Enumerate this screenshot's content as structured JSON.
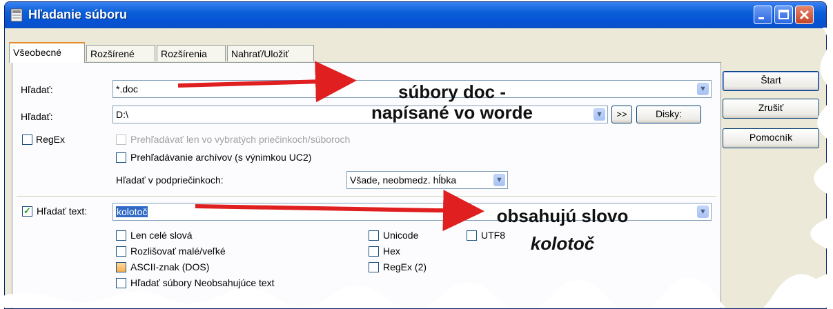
{
  "window": {
    "title": "Hľadanie súboru",
    "colors": {
      "titlebar": "#0a5fd8",
      "arrow": "#e02020",
      "face": "#ece9d8"
    }
  },
  "tabs": [
    {
      "label": "Všeobecné",
      "active": true
    },
    {
      "label": "Rozšírené",
      "active": false
    },
    {
      "label": "Rozšírenia",
      "active": false
    },
    {
      "label": "Nahrať/Uložiť",
      "active": false
    }
  ],
  "general": {
    "search_label": "Hľadať:",
    "search_value": "*.doc",
    "path_label": "Hľadať:",
    "path_value": "D:\\",
    "more_button": ">>",
    "drives_button": "Disky:",
    "regex_label": "RegEx",
    "selected_only_label": "Prehľadávať len vo vybratých priečinkoch/súboroch",
    "archives_label": "Prehľadávanie archívov (s výnimkou UC2)",
    "subfolders_label": "Hľadať v podpriečinkoch:",
    "subfolders_value": "Všade, neobmedz. hĺbka"
  },
  "text_search": {
    "checkbox_label": "Hľadať text:",
    "checked": true,
    "value": "kolotoč",
    "options": {
      "whole_words": "Len celé slová",
      "case_sensitive": "Rozlišovať malé/veľké",
      "ascii": "ASCII-znak (DOS)",
      "not_containing": "Hľadať súbory Neobsahujúce text",
      "unicode": "Unicode",
      "hex": "Hex",
      "regex2": "RegEx (2)",
      "utf8": "UTF8"
    }
  },
  "buttons": {
    "start": "Štart",
    "cancel": "Zrušiť",
    "help": "Pomocník"
  },
  "annotations": {
    "first_line1": "súbory doc -",
    "first_line2": "napísané vo worde",
    "second_line1": "obsahujú slovo",
    "second_line2": "kolotoč"
  }
}
